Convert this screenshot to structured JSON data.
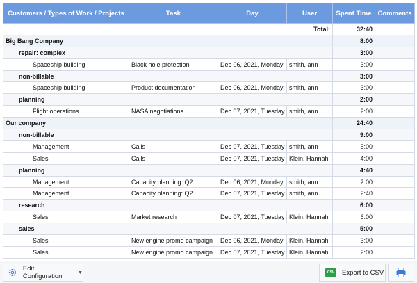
{
  "columns": [
    "Customers / Types of Work / Projects",
    "Task",
    "Day",
    "User",
    "Spent Time",
    "Comments"
  ],
  "total": {
    "label": "Total:",
    "time": "32:40"
  },
  "rows": [
    {
      "kind": "group",
      "label": "Big Bang Company",
      "time": "8:00"
    },
    {
      "kind": "sub",
      "label": "repair: complex",
      "time": "3:00"
    },
    {
      "kind": "leaf",
      "label": "Spaceship building",
      "task": "Black hole protection",
      "day": "Dec 06, 2021, Monday",
      "user": "smith, ann",
      "time": "3:00"
    },
    {
      "kind": "sub",
      "label": "non-billable",
      "time": "3:00"
    },
    {
      "kind": "leaf",
      "label": "Spaceship building",
      "task": "Product documentation",
      "day": "Dec 06, 2021, Monday",
      "user": "smith, ann",
      "time": "3:00"
    },
    {
      "kind": "sub",
      "label": "planning",
      "time": "2:00"
    },
    {
      "kind": "leaf",
      "label": "Flight operations",
      "task": "NASA negotiations",
      "day": "Dec 07, 2021, Tuesday",
      "user": "smith, ann",
      "time": "2:00"
    },
    {
      "kind": "group",
      "label": "Our company",
      "time": "24:40"
    },
    {
      "kind": "sub",
      "label": "non-billable",
      "time": "9:00"
    },
    {
      "kind": "leaf",
      "label": "Management",
      "task": "Calls",
      "day": "Dec 07, 2021, Tuesday",
      "user": "smith, ann",
      "time": "5:00"
    },
    {
      "kind": "leaf",
      "label": "Sales",
      "task": "Calls",
      "day": "Dec 07, 2021, Tuesday",
      "user": "Klein, Hannah",
      "time": "4:00"
    },
    {
      "kind": "sub",
      "label": "planning",
      "time": "4:40"
    },
    {
      "kind": "leaf",
      "label": "Management",
      "task": "Capacity planning: Q2",
      "day": "Dec 06, 2021, Monday",
      "user": "smith, ann",
      "time": "2:00"
    },
    {
      "kind": "leaf",
      "label": "Management",
      "task": "Capacity planning: Q2",
      "day": "Dec 07, 2021, Tuesday",
      "user": "smith, ann",
      "time": "2:40"
    },
    {
      "kind": "sub",
      "label": "research",
      "time": "6:00"
    },
    {
      "kind": "leaf",
      "label": "Sales",
      "task": "Market research",
      "day": "Dec 07, 2021, Tuesday",
      "user": "Klein, Hannah",
      "time": "6:00"
    },
    {
      "kind": "sub",
      "label": "sales",
      "time": "5:00"
    },
    {
      "kind": "leaf",
      "label": "Sales",
      "task": "New engine promo campaign",
      "day": "Dec 06, 2021, Monday",
      "user": "Klein, Hannah",
      "time": "3:00"
    },
    {
      "kind": "leaf",
      "label": "Sales",
      "task": "New engine promo campaign",
      "day": "Dec 07, 2021, Tuesday",
      "user": "Klein, Hannah",
      "time": "2:00"
    }
  ],
  "toolbar": {
    "config_label": "Edit Configuration",
    "config_icon": "gear-icon",
    "export_label": "Export to CSV",
    "export_icon": "csv-icon",
    "csv_badge": "CSV",
    "print_icon": "printer-icon"
  }
}
